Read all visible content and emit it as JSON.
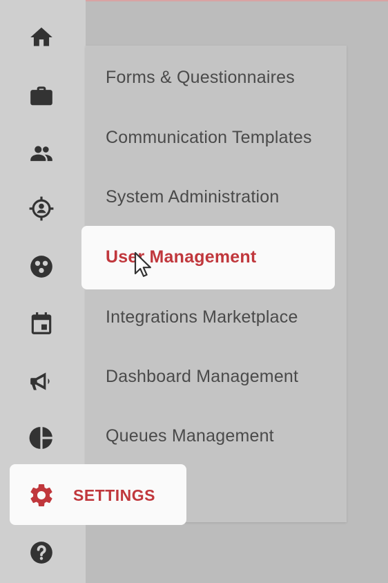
{
  "colors": {
    "accent": "#c0373c",
    "icon": "#333333",
    "text": "#4a4a4a"
  },
  "sidebar": {
    "icons": [
      "home-icon",
      "briefcase-icon",
      "people-icon",
      "target-person-icon",
      "network-icon",
      "calendar-icon",
      "megaphone-icon",
      "pie-chart-icon",
      "gear-icon",
      "help-icon"
    ],
    "settings_label": "SETTINGS"
  },
  "flyout": {
    "items": [
      {
        "label": "Forms & Questionnaires"
      },
      {
        "label": "Communication Templates"
      },
      {
        "label": "System Administration"
      },
      {
        "label": "User Management",
        "active": true
      },
      {
        "label": "Integrations Marketplace"
      },
      {
        "label": "Dashboard Management"
      },
      {
        "label": "Queues Management"
      }
    ]
  }
}
